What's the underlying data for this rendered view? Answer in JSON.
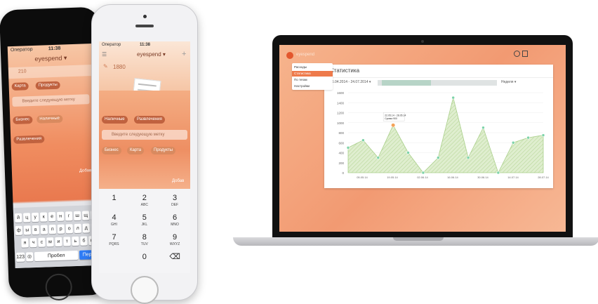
{
  "back_phone": {
    "status": {
      "carrier": "Оператор",
      "time": "11:38"
    },
    "title": "eyespend ▾",
    "amount": "210",
    "tags_row1": [
      "Карта",
      "Продукты"
    ],
    "placeholder": "Введите следующую метку",
    "tags_row2": [
      "Бизнес",
      "Наличные"
    ],
    "tags_row3": [
      "Развлечения"
    ],
    "add_label": "Добави",
    "keyboard": {
      "row1": [
        "й",
        "ц",
        "у",
        "к",
        "е",
        "н",
        "г",
        "ш",
        "щ",
        "з"
      ],
      "row2": [
        "ф",
        "ы",
        "в",
        "а",
        "п",
        "р",
        "о",
        "л",
        "д",
        "ж"
      ],
      "row3": [
        "я",
        "ч",
        "с",
        "м",
        "и",
        "т",
        "ь",
        "б",
        "ю"
      ],
      "num_key": "123",
      "space": "Пробел",
      "go": "Перей"
    }
  },
  "front_phone": {
    "status": {
      "carrier": "Оператор",
      "time": "11:38"
    },
    "title": "eyespend ▾",
    "amount": "1880",
    "tags_row1": [
      "Наличные",
      "Развлечения"
    ],
    "placeholder": "Введите следующую метку",
    "tags_row2": [
      "Бизнес",
      "Карта",
      "Продукты"
    ],
    "add_label": "Добав",
    "numpad": [
      {
        "n": "1",
        "s": ""
      },
      {
        "n": "2",
        "s": "ABC"
      },
      {
        "n": "3",
        "s": "DEF"
      },
      {
        "n": "4",
        "s": "GHI"
      },
      {
        "n": "5",
        "s": "JKL"
      },
      {
        "n": "6",
        "s": "MNO"
      },
      {
        "n": "7",
        "s": "PQRS"
      },
      {
        "n": "8",
        "s": "TUV"
      },
      {
        "n": "9",
        "s": "WXYZ"
      },
      {
        "n": "",
        "s": ""
      },
      {
        "n": "0",
        "s": ""
      },
      {
        "n": "⌫",
        "s": ""
      }
    ]
  },
  "laptop": {
    "app_name": "eyespend",
    "sidebar": [
      {
        "label": "Расходы",
        "active": false
      },
      {
        "label": "Статистика",
        "active": true
      },
      {
        "label": "По тегам",
        "active": false
      },
      {
        "label": "Настройки",
        "active": false
      }
    ],
    "title": "Статистика",
    "date_range": "16.04.2014 - 24.07.2014 ▾",
    "period": "Неделя ▾",
    "tooltip": {
      "date": "22.05.14 - 28.05.14",
      "value": "Сумма 900"
    },
    "accent": "#ee7a4b"
  },
  "chart_data": {
    "type": "area",
    "x": [
      "22.04.14",
      "29.04.14",
      "06.05.14",
      "13.05.14",
      "20.05.14",
      "27.05.14",
      "03.06.14",
      "10.06.14",
      "17.06.14",
      "24.06.14",
      "01.07.14",
      "08.07.14",
      "15.07.14",
      "22.07.14"
    ],
    "x_tick_labels": [
      "05.05.14",
      "19.05.14",
      "02.06.14",
      "16.06.14",
      "30.06.14",
      "14.07.14",
      "28.07.14"
    ],
    "values": [
      500,
      650,
      300,
      950,
      400,
      0,
      300,
      1500,
      300,
      900,
      0,
      600,
      700,
      750
    ],
    "yticks": [
      0,
      200,
      400,
      600,
      800,
      1000,
      1200,
      1400,
      1600
    ],
    "ylim": [
      0,
      1600
    ],
    "highlight_index": 3,
    "title": "",
    "xlabel": "",
    "ylabel": ""
  }
}
